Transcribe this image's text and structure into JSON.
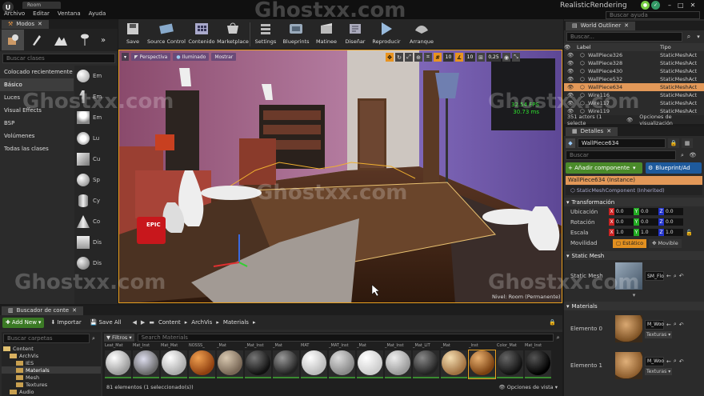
{
  "window": {
    "title": "RealisticRendering",
    "tab": "Room",
    "search_help": "Buscar ayuda"
  },
  "menu": [
    "Archivo",
    "Editar",
    "Ventana",
    "Ayuda"
  ],
  "modes": {
    "tab": "Modos",
    "search": "Buscar clases",
    "categories": [
      "Colocado recientemente",
      "Básico",
      "Luces",
      "Visual Effects",
      "BSP",
      "Volúmenes",
      "Todas las clases"
    ],
    "items": [
      "Em",
      "Em",
      "Em",
      "Lu",
      "Cu",
      "Sp",
      "Cy",
      "Co",
      "Dis",
      "Dis"
    ]
  },
  "toolbar": [
    "Save",
    "Source Control",
    "Contenido",
    "Marketplace",
    "Settings",
    "Blueprints",
    "Matinee",
    "Diseñar",
    "Reproducir",
    "Arranque"
  ],
  "viewport": {
    "perspective": "Perspectiva",
    "lit": "Iluminado",
    "show": "Mostrar",
    "grid1": "10",
    "grid2": "10",
    "scale": "0,25",
    "fps": "32.54 FPS",
    "ms": "30.73 ms",
    "level": "Nivel:  Room (Permanente)",
    "mug": "EPIC"
  },
  "outliner": {
    "tab": "World Outliner",
    "search": "Buscar...",
    "col_label": "Label",
    "col_type": "Tipo",
    "rows": [
      [
        "WallPiece326",
        "StaticMeshAct"
      ],
      [
        "WallPiece328",
        "StaticMeshAct"
      ],
      [
        "WallPiece430",
        "StaticMeshAct"
      ],
      [
        "WallPiece532",
        "StaticMeshAct"
      ],
      [
        "WallPiece634",
        "StaticMeshAct"
      ],
      [
        "Wire116",
        "StaticMeshAct"
      ],
      [
        "Wire117",
        "StaticMeshAct"
      ],
      [
        "Wire119",
        "StaticMeshAct"
      ]
    ],
    "status": "351 actors (1 selecte",
    "view_options": "Opciones de visualización"
  },
  "details": {
    "tab": "Detalles",
    "name": "WallPiece634",
    "search": "Buscar",
    "add": "+ Añadir componente",
    "blueprint": "Blueprint/Ad",
    "instance": "WallPiece634 (Instance)",
    "component": "StaticMeshComponent (Inherited)",
    "transform": "Transformación",
    "location": "Ubicación",
    "rotation": "Rotación",
    "scale": "Escala",
    "mobility": "Movilidad",
    "static": "Estático",
    "movable": "Movible",
    "loc": [
      "0.0",
      "0.0",
      "0.0"
    ],
    "rot": [
      "0.0",
      "0.0",
      "0.0"
    ],
    "scl": [
      "1.0",
      "1.0",
      "1.0"
    ],
    "static_mesh_section": "Static Mesh",
    "static_mesh_label": "Static Mesh",
    "mesh_value": "SM_Flo",
    "materials": "Materials",
    "element0": "Elemento 0",
    "element1": "Elemento 1",
    "mat0": "M_Woo",
    "mat1": "M_Woo",
    "textures": "Texturas"
  },
  "browser": {
    "tab": "Buscador de conte",
    "add_new": "Add New",
    "import": "Importar",
    "save_all": "Save All",
    "path": [
      "Content",
      "ArchVis",
      "Materials"
    ],
    "folder_search": "Buscar carpetas",
    "filters": "Filtros",
    "mat_search": "Search Materials",
    "tree": [
      "Content",
      "ArchVis",
      "IES",
      "Materials",
      "Mesh",
      "Textures",
      "Audio"
    ],
    "thumb_labels": [
      "Leat_Mat",
      "Mat_Inst",
      "Mat_Mat",
      "NOSSS_",
      "_Mat",
      "_Mat_Inst",
      "_Mat",
      "MAT",
      "_MAT_Inst",
      "_Mat",
      "_Mat_Inst",
      "_Mat_LIT",
      "_Mat",
      "_Inst",
      "Color_Mat",
      "Mat_Inst"
    ],
    "status": "81 elementos (1 seleccionado(s))",
    "view_options": "Opciones de vista"
  },
  "watermark": "Ghostxx.com"
}
